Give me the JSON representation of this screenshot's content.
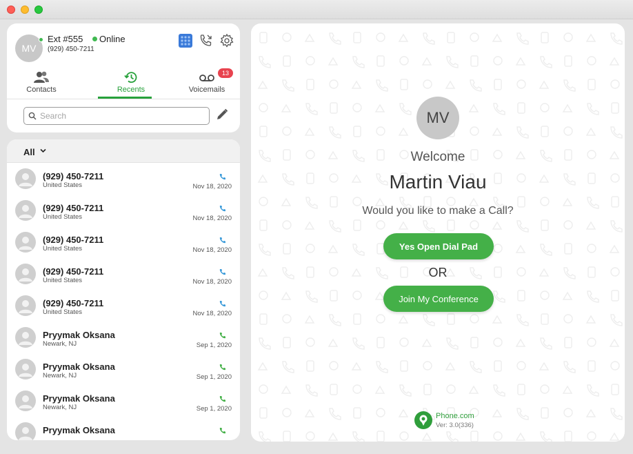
{
  "header": {
    "avatar_initials": "MV",
    "extension": "Ext #555",
    "status": "Online",
    "phone": "(929) 450-7211"
  },
  "icons": {
    "dialpad": "grid-icon",
    "call_options": "phone-arrow-icon",
    "settings": "gear-icon",
    "compose": "pencil-icon"
  },
  "tabs": [
    {
      "label": "Contacts",
      "active": false
    },
    {
      "label": "Recents",
      "active": true
    },
    {
      "label": "Voicemails",
      "active": false,
      "badge": "13"
    }
  ],
  "search": {
    "placeholder": "Search",
    "value": ""
  },
  "filter": {
    "label": "All"
  },
  "recents": [
    {
      "name": "(929) 450-7211",
      "location": "United States",
      "date": "Nov 18, 2020",
      "call_color": "#3a9ad9"
    },
    {
      "name": "(929) 450-7211",
      "location": "United States",
      "date": "Nov 18, 2020",
      "call_color": "#3a9ad9"
    },
    {
      "name": "(929) 450-7211",
      "location": "United States",
      "date": "Nov 18, 2020",
      "call_color": "#3a9ad9"
    },
    {
      "name": "(929) 450-7211",
      "location": "United States",
      "date": "Nov 18, 2020",
      "call_color": "#3a9ad9"
    },
    {
      "name": "(929) 450-7211",
      "location": "United States",
      "date": "Nov 18, 2020",
      "call_color": "#3a9ad9"
    },
    {
      "name": "Pryymak Oksana",
      "location": "Newark, NJ",
      "date": "Sep 1, 2020",
      "call_color": "#44b048"
    },
    {
      "name": "Pryymak Oksana",
      "location": "Newark, NJ",
      "date": "Sep 1, 2020",
      "call_color": "#44b048"
    },
    {
      "name": "Pryymak Oksana",
      "location": "Newark, NJ",
      "date": "Sep 1, 2020",
      "call_color": "#44b048"
    },
    {
      "name": "Pryymak Oksana",
      "location": "",
      "date": "",
      "call_color": "#44b048"
    }
  ],
  "main": {
    "avatar_initials": "MV",
    "welcome": "Welcome",
    "user_name": "Martin Viau",
    "question": "Would you like to make a Call?",
    "dialpad_button": "Yes Open Dial Pad",
    "or_text": "OR",
    "conference_button": "Join My Conference"
  },
  "brand": {
    "name": "Phone.com",
    "version": "Ver: 3.0(336)",
    "color": "#2f9e3b"
  },
  "colors": {
    "accent": "#27a13b",
    "button": "#44b048",
    "badge": "#e8434f",
    "online": "#3fb950"
  }
}
